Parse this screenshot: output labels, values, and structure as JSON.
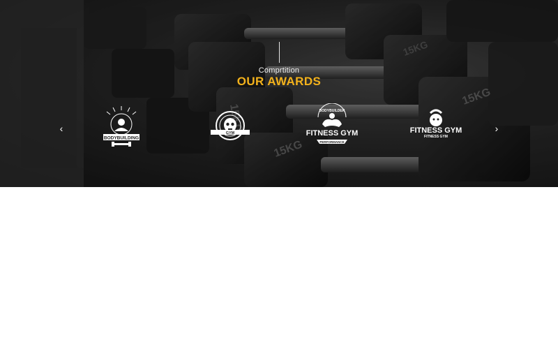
{
  "section": {
    "kicker": "Comprtition",
    "title": "OUR AWARDS",
    "accent_color": "#f3b21c"
  },
  "carousel": {
    "prev_icon": "chevron-left-icon",
    "next_icon": "chevron-right-icon",
    "prev_glyph": "‹",
    "next_glyph": "›",
    "logos": [
      {
        "name": "bodybuilding-badge",
        "text": "BODYBUILDING"
      },
      {
        "name": "skull-gym-badge",
        "text": "GYM"
      },
      {
        "name": "fitness-gym-bodybuilder",
        "top": "BODYBUILDER",
        "text": "FITNESS GYM",
        "sub": "PERFORMANCE"
      },
      {
        "name": "fitness-gym-kettlebell",
        "text": "FITNESS GYM",
        "sub": "FITNESS GYM"
      }
    ]
  }
}
